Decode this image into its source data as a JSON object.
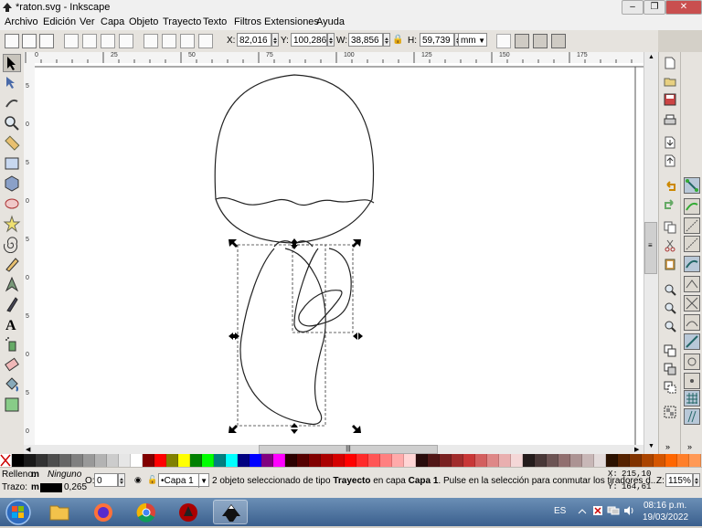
{
  "window": {
    "title": "*raton.svg - Inkscape"
  },
  "menu": [
    "Archivo",
    "Edición",
    "Ver",
    "Capa",
    "Objeto",
    "Trayecto",
    "Texto",
    "Filtros",
    "Extensiones",
    "Ayuda"
  ],
  "toolbar": {
    "x_label": "X:",
    "x_value": "82,016",
    "y_label": "Y:",
    "y_value": "100,286",
    "w_label": "W:",
    "w_value": "38,856",
    "h_label": "H:",
    "h_value": "59,739",
    "unit": "mm"
  },
  "rulers": {
    "top": [
      "0",
      "25",
      "50",
      "75",
      "100",
      "125",
      "150",
      "175"
    ],
    "left": [
      "5",
      "0",
      "5",
      "0",
      "5",
      "0",
      "5",
      "0",
      "5",
      "0"
    ]
  },
  "scrollbar": {
    "h_grip": "|||",
    "v_grip": "≡"
  },
  "status": {
    "fill_label": "Relleno:",
    "fill_value": "m",
    "fill_none": "Ninguno",
    "stroke_label": "Trazo:",
    "stroke_value": "m",
    "stroke_width": "0,265",
    "opacity_label": "O:",
    "opacity_value": "0",
    "layer": "•Capa 1",
    "message_pre": "2 objeto seleccionado de tipo ",
    "message_type": "Trayecto",
    "message_mid": " en capa ",
    "message_layer": "Capa 1",
    "message_post": ". Pulse en la selección para conmutar los tiradores d...",
    "coord_x_label": "X:",
    "coord_x": "215,10",
    "coord_y_label": "Y:",
    "coord_y": "164,61",
    "zoom_label": "Z:",
    "zoom": "115%"
  },
  "taskbar": {
    "lang": "ES",
    "time": "08:16 p.m.",
    "date": "19/03/2022"
  },
  "colors": {
    "accent": "#3a5f8d",
    "palette": [
      "#000000",
      "#1a1a1a",
      "#333333",
      "#4d4d4d",
      "#666666",
      "#808080",
      "#999999",
      "#b3b3b3",
      "#cccccc",
      "#e6e6e6",
      "#ffffff",
      "#800000",
      "#ff0000",
      "#808000",
      "#ffff00",
      "#008000",
      "#00ff00",
      "#008080",
      "#00ffff",
      "#000080",
      "#0000ff",
      "#800080",
      "#ff00ff",
      "#2b0000",
      "#550000",
      "#800000",
      "#aa0000",
      "#d40000",
      "#ff0000",
      "#ff2a2a",
      "#ff5555",
      "#ff8080",
      "#ffaaaa",
      "#ffd5d5",
      "#280b0b",
      "#501616",
      "#782121",
      "#a02c2c",
      "#c83737",
      "#d35f5f",
      "#de8787",
      "#e9afaf",
      "#f4d7d7",
      "#241c1c",
      "#483737",
      "#6c5353",
      "#916f6f",
      "#ac9393",
      "#c8b7b7",
      "#e3dbdb",
      "#2b1100",
      "#552200",
      "#803300",
      "#aa4400",
      "#d45500",
      "#ff6600",
      "#ff7f2a",
      "#ff9955"
    ]
  }
}
